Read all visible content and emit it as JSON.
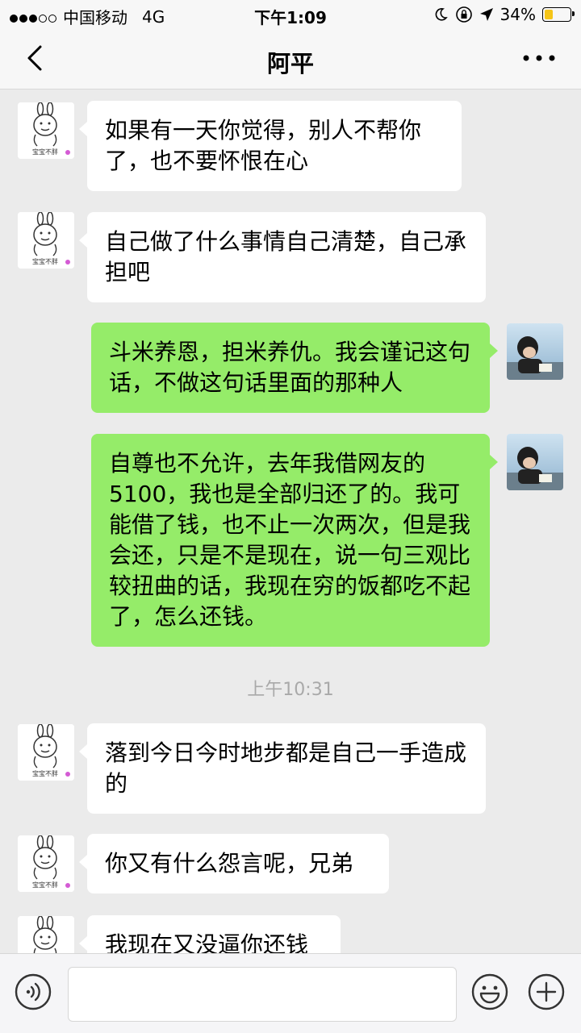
{
  "status_bar": {
    "carrier": "中国移动",
    "network": "4G",
    "time": "下午1:09",
    "battery_percent_text": "34%",
    "battery_level": 0.34,
    "signal_bars_filled": 3,
    "signal_bars_total": 5
  },
  "navbar": {
    "title": "阿平",
    "back_icon": "chevron-left-icon",
    "more_icon": "more-dots-icon"
  },
  "messages": [
    {
      "side": "in",
      "text": "如果有一天你觉得，别人不帮你了，也不要怀恨在心"
    },
    {
      "side": "in",
      "text": "自己做了什么事情自己清楚，自己承担吧"
    },
    {
      "side": "out",
      "text": "斗米养恩，担米养仇。我会谨记这句话，不做这句话里面的那种人"
    },
    {
      "side": "out",
      "text": "自尊也不允许，去年我借网友的5100，我也是全部归还了的。我可能借了钱，也不止一次两次，但是我会还，只是不是现在，说一句三观比较扭曲的话，我现在穷的饭都吃不起了，怎么还钱。"
    },
    {
      "side": "in",
      "text": "落到今日今时地步都是自己一手造成的"
    },
    {
      "side": "in",
      "text": "你又有什么怨言呢，兄弟"
    },
    {
      "side": "in",
      "text": "我现在又没逼你还钱"
    }
  ],
  "timestamp": "上午10:31",
  "contact_avatar_caption": "宝宝不胖",
  "input_bar": {
    "value": "",
    "voice_icon": "voice-icon",
    "emoji_icon": "emoji-icon",
    "plus_icon": "plus-icon"
  },
  "colors": {
    "outgoing_bubble": "#95ec69",
    "incoming_bubble": "#ffffff",
    "background": "#ebebeb",
    "battery": "#f5c518"
  }
}
